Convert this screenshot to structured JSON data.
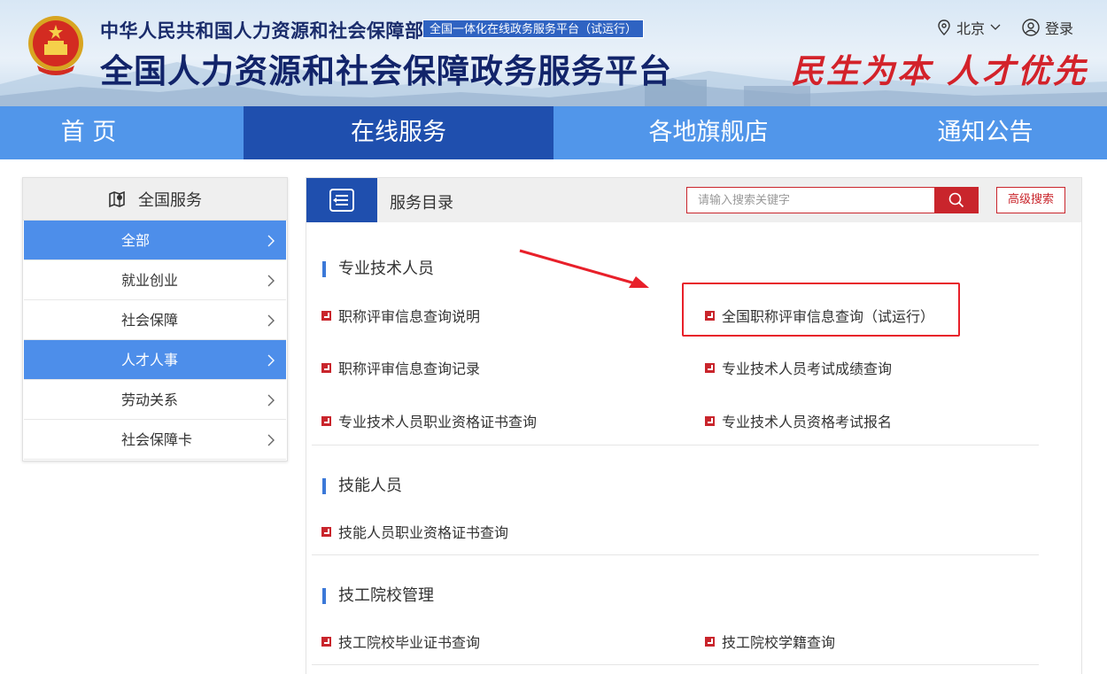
{
  "header": {
    "ministry_name": "中华人民共和国人力资源和社会保障部",
    "badge": "全国一体化在线政务服务平台（试运行）",
    "platform_title": "全国人力资源和社会保障政务服务平台",
    "slogan": "民生为本 人才优先",
    "location": "北京",
    "login": "登录"
  },
  "nav": {
    "items": [
      "首 页",
      "在线服务",
      "各地旗舰店",
      "通知公告"
    ],
    "active": "在线服务"
  },
  "sidebar": {
    "title": "全国服务",
    "items": [
      {
        "label": "全部",
        "active": true
      },
      {
        "label": "就业创业",
        "active": false
      },
      {
        "label": "社会保障",
        "active": false
      },
      {
        "label": "人才人事",
        "active": true
      },
      {
        "label": "劳动关系",
        "active": false
      },
      {
        "label": "社会保障卡",
        "active": false
      }
    ]
  },
  "main": {
    "title": "服务目录",
    "search_placeholder": "请输入搜索关键字",
    "advanced_search": "高级搜索",
    "sections": [
      {
        "title": "专业技术人员",
        "links": [
          "职称评审信息查询说明",
          "全国职称评审信息查询（试运行）",
          "职称评审信息查询记录",
          "专业技术人员考试成绩查询",
          "专业技术人员职业资格证书查询",
          "专业技术人员资格考试报名"
        ]
      },
      {
        "title": "技能人员",
        "links": [
          "技能人员职业资格证书查询"
        ]
      },
      {
        "title": "技工院校管理",
        "links": [
          "技工院校毕业证书查询",
          "技工院校学籍查询"
        ]
      }
    ]
  },
  "colors": {
    "nav_bg": "#5196ea",
    "nav_active": "#1f4fae",
    "accent_red": "#c9252c",
    "sidebar_active": "#4d8eea"
  }
}
